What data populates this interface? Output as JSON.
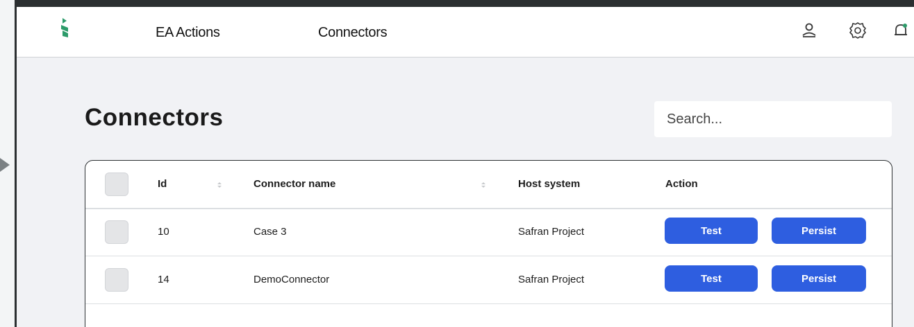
{
  "nav": {
    "links": [
      "EA Actions",
      "Connectors"
    ]
  },
  "page": {
    "title": "Connectors"
  },
  "search": {
    "placeholder": "Search..."
  },
  "table": {
    "columns": [
      "Id",
      "Connector name",
      "Host system",
      "Action"
    ],
    "rows": [
      {
        "id": "10",
        "name": "Case 3",
        "host": "Safran Project"
      },
      {
        "id": "14",
        "name": "DemoConnector",
        "host": "Safran Project"
      }
    ],
    "actions": {
      "test_label": "Test",
      "persist_label": "Persist"
    }
  },
  "colors": {
    "brand_green": "#2d9b6a",
    "button_blue": "#2e5ee0",
    "background": "#f1f2f5"
  }
}
